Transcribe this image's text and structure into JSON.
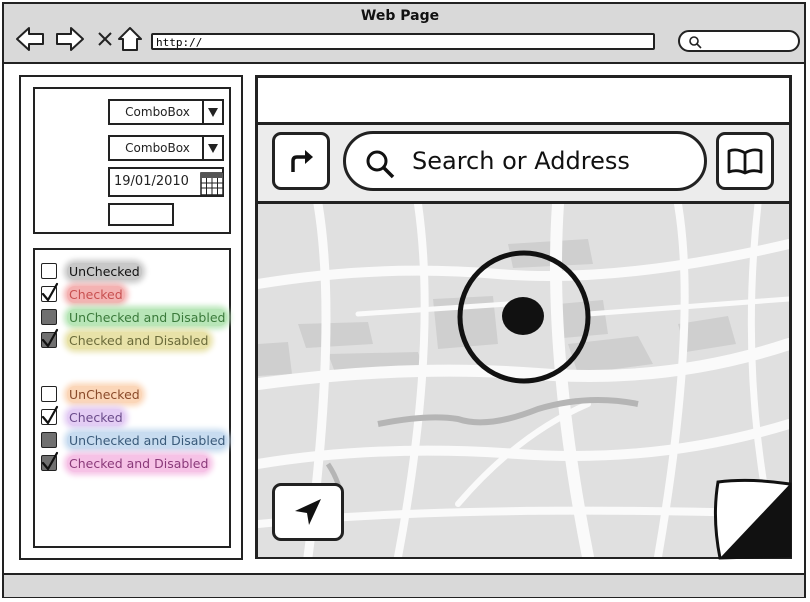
{
  "window": {
    "title": "Web Page"
  },
  "addressbar": {
    "url": "http://"
  },
  "form": {
    "combo1": "ComboBox",
    "combo2": "ComboBox",
    "date": "19/01/2010",
    "textbox": ""
  },
  "checkboxes": [
    {
      "label": "UnChecked",
      "checked": false,
      "disabled": false,
      "highlight": "#c8c8c8"
    },
    {
      "label": "Checked",
      "checked": true,
      "disabled": false,
      "highlight": "#f4b2b2"
    },
    {
      "label": "UnChecked and Disabled",
      "checked": false,
      "disabled": true,
      "highlight": "#b8e6b8"
    },
    {
      "label": "Checked and Disabled",
      "checked": true,
      "disabled": true,
      "highlight": "#e8e2a8"
    },
    {
      "label": "UnChecked",
      "checked": false,
      "disabled": false,
      "highlight": "#fbd6b8"
    },
    {
      "label": "Checked",
      "checked": true,
      "disabled": false,
      "highlight": "#e4cdf4"
    },
    {
      "label": "UnChecked and Disabled",
      "checked": false,
      "disabled": true,
      "highlight": "#c8dcf0"
    },
    {
      "label": "Checked and Disabled",
      "checked": true,
      "disabled": true,
      "highlight": "#f6c2e6"
    }
  ],
  "map": {
    "search_placeholder": "Search or Address"
  },
  "icons": {
    "back": "back-arrow-icon",
    "forward": "forward-arrow-icon",
    "close": "close-icon",
    "home": "home-icon",
    "search": "search-icon",
    "directions": "directions-icon",
    "bookmarks": "book-icon",
    "location": "location-arrow-icon",
    "page_curl": "page-curl-icon"
  }
}
